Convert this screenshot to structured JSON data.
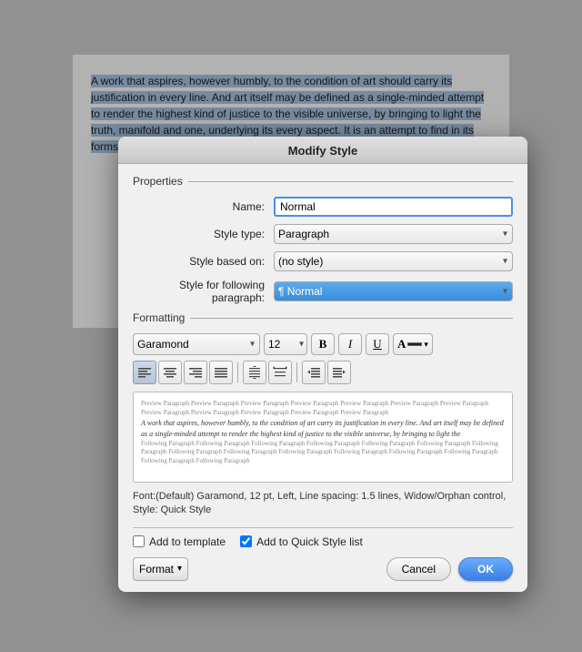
{
  "document": {
    "background_color": "#d0d0d0",
    "selected_text": "A work that aspires, however humbly, to the condition of art should carry its justification in every line. And art itself may be defined as a single-minded attempt to render the highest kind of justice to the visible universe, by bringing to light the truth, manifold and one, underlying its every aspect. It is an attempt to find in its forms, in its colours, in its light, in its shadow"
  },
  "dialog": {
    "title": "Modify Style",
    "properties_label": "Properties",
    "formatting_label": "Formatting",
    "name_label": "Name:",
    "name_value": "Normal",
    "style_type_label": "Style type:",
    "style_type_value": "Paragraph",
    "style_based_label": "Style based on:",
    "style_based_value": "(no style)",
    "style_following_label": "Style for following paragraph:",
    "style_following_value": "Normal",
    "font_name": "Garamond",
    "font_size": "12",
    "bold_label": "B",
    "italic_label": "I",
    "underline_label": "U",
    "font_desc": "Font:(Default) Garamond, 12 pt, Left, Line spacing:  1.5 lines, Widow/Orphan control, Style: Quick Style",
    "add_to_template_label": "Add to template",
    "add_to_template_checked": false,
    "add_to_quick_label": "Add to Quick Style list",
    "add_to_quick_checked": true,
    "format_label": "Format",
    "cancel_label": "Cancel",
    "ok_label": "OK"
  }
}
